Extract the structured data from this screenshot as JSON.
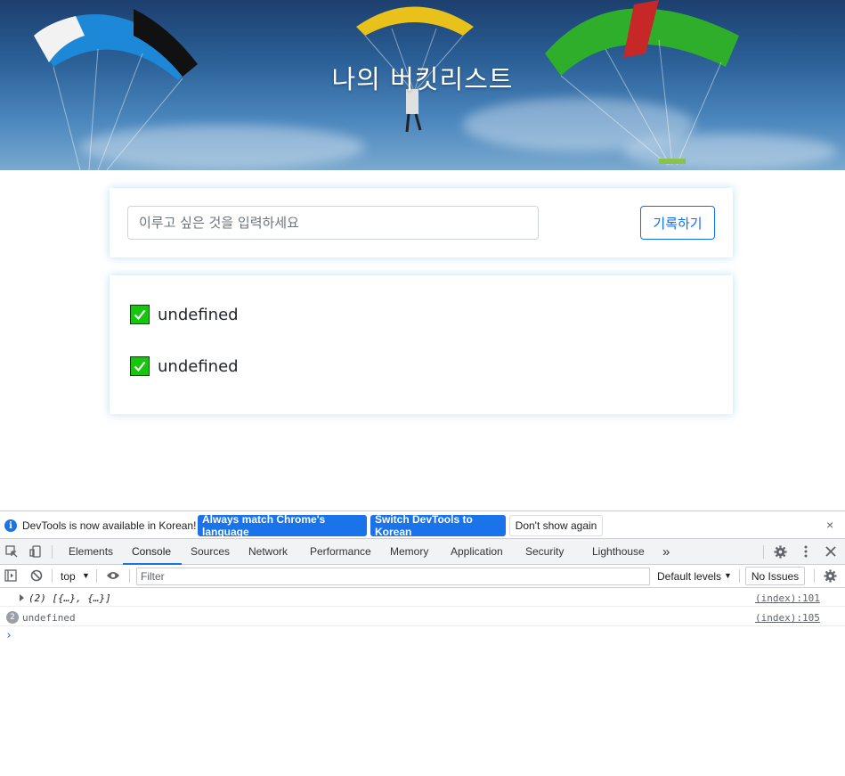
{
  "page": {
    "title": "나의 버킷리스트",
    "input_placeholder": "이루고 싶은 것을 입력하세요",
    "save_label": "기록하기",
    "items": [
      {
        "text": "undefined",
        "checked": true
      },
      {
        "text": "undefined",
        "checked": true
      }
    ],
    "colors": {
      "accent": "#0d6efd",
      "check": "#16c60c"
    }
  },
  "devtools": {
    "infobar": {
      "message": "DevTools is now available in Korean!",
      "btn_match": "Always match Chrome's language",
      "btn_switch": "Switch DevTools to Korean",
      "btn_dismiss": "Don't show again",
      "close": "×"
    },
    "tabs": [
      "Elements",
      "Console",
      "Sources",
      "Network",
      "Performance",
      "Memory",
      "Application",
      "Security",
      "Lighthouse"
    ],
    "active_tab": "Console",
    "more_tabs": "»",
    "toolbar": {
      "context": "top",
      "filter_placeholder": "Filter",
      "levels": "Default levels",
      "issues": "No Issues"
    },
    "logs": [
      {
        "text": "(2) [{…}, {…}]",
        "source": "(index):101"
      },
      {
        "count": "2",
        "text": "undefined",
        "source": "(index):105"
      }
    ],
    "prompt": "›"
  }
}
